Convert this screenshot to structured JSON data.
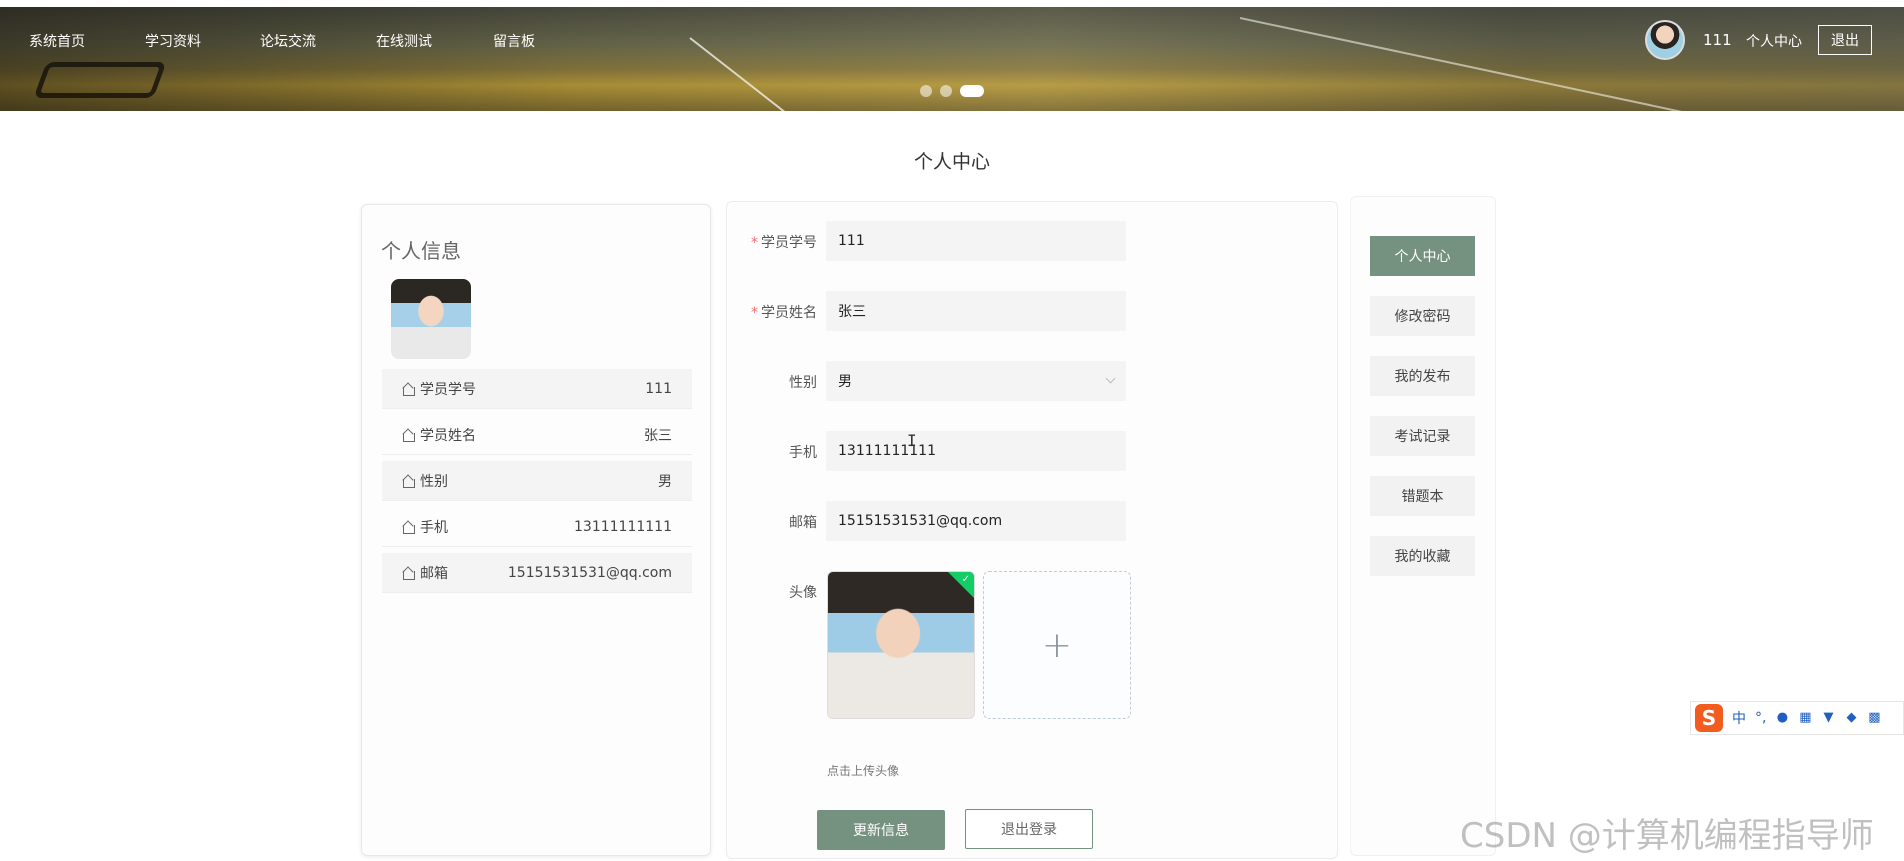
{
  "nav": {
    "items": [
      "系统首页",
      "学习资料",
      "论坛交流",
      "在线测试",
      "留言板"
    ],
    "user_name": "111",
    "user_center": "个人中心",
    "logout": "退出"
  },
  "carousel": {
    "slides": 3,
    "active_index": 3
  },
  "page_title": "个人中心",
  "profile_card": {
    "title": "个人信息",
    "rows": [
      {
        "label": "学员学号",
        "value": "111"
      },
      {
        "label": "学员姓名",
        "value": "张三"
      },
      {
        "label": "性别",
        "value": "男"
      },
      {
        "label": "手机",
        "value": "13111111111"
      },
      {
        "label": "邮箱",
        "value": "15151531531@qq.com"
      }
    ]
  },
  "form": {
    "student_id": {
      "label": "学员学号",
      "value": "111"
    },
    "student_name": {
      "label": "学员姓名",
      "value": "张三"
    },
    "gender": {
      "label": "性别",
      "value": "男"
    },
    "phone": {
      "label": "手机",
      "value": "13111111111"
    },
    "email": {
      "label": "邮箱",
      "value": "15151531531@qq.com"
    },
    "avatar": {
      "label": "头像",
      "hint": "点击上传头像"
    },
    "required_mark": "*",
    "update_button": "更新信息",
    "logout_button": "退出登录"
  },
  "side_menu": {
    "items": [
      "个人中心",
      "修改密码",
      "我的发布",
      "考试记录",
      "错题本",
      "我的收藏"
    ],
    "active": "个人中心"
  },
  "ime": {
    "logo": "S",
    "mode": "中",
    "punct": "°,"
  },
  "watermark": "CSDN @计算机编程指导师",
  "colors": {
    "accent": "#75917f",
    "required": "#f56c6c",
    "success": "#13ce66"
  },
  "icons": [
    "house-icon",
    "chevron-down-icon",
    "plus-icon",
    "check-icon",
    "mic-icon",
    "keyboard-icon",
    "shirt-icon",
    "gamepad-icon",
    "grid-icon"
  ]
}
